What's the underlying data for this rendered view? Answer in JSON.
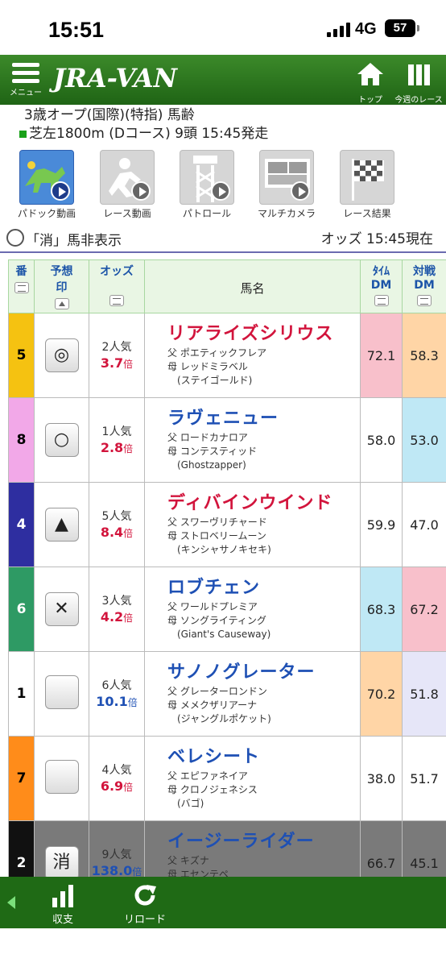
{
  "status": {
    "time": "15:51",
    "network": "4G",
    "battery": "57"
  },
  "header": {
    "menu_label": "メニュー",
    "logo": "JRA-VAN",
    "top_label": "トップ",
    "week_label": "今週のレース"
  },
  "race": {
    "line1": "3歳オープ(国際)(特指) 馬齢",
    "line2": "芝左1800m (Dコース) 9頭 15:45発走"
  },
  "media": [
    {
      "label": "パドック動画",
      "icon": "paddock-icon",
      "active": true
    },
    {
      "label": "レース動画",
      "icon": "jockey-icon",
      "active": false
    },
    {
      "label": "パトロール",
      "icon": "tower-icon",
      "active": false
    },
    {
      "label": "マルチカメラ",
      "icon": "multicam-icon",
      "active": false
    },
    {
      "label": "レース結果",
      "icon": "checkered-flag-icon",
      "active": false
    }
  ],
  "options": {
    "hide_label": "「消」馬非表示",
    "odds_time": "オッズ 15:45現在"
  },
  "table": {
    "headers": {
      "gate": "番",
      "mark_1": "予想",
      "mark_2": "印",
      "odds": "オッズ",
      "name": "馬名",
      "time_dm_1": "ﾀｲﾑ",
      "time_dm_2": "DM",
      "battle_dm_1": "対戦",
      "battle_dm_2": "DM"
    },
    "rows": [
      {
        "gate": "5",
        "gate_color": "#f5c211",
        "gate_text": "#000000",
        "mark": "◎",
        "pop": "2人気",
        "odds": "3.7",
        "odds_unit": "倍",
        "odds_color": "#d2143c",
        "name": "リアライズシリウス",
        "name_color": "#d2143c",
        "sire": "父 ポエティックフレア",
        "dam": "母 レッドミラベル",
        "bms": "(ステイゴールド)",
        "time_dm": "72.1",
        "time_bg": "#f8c0cb",
        "battle_dm": "58.3",
        "battle_bg": "#ffd5a6"
      },
      {
        "gate": "8",
        "gate_color": "#f2a8e8",
        "gate_text": "#000000",
        "mark": "○",
        "pop": "1人気",
        "odds": "2.8",
        "odds_unit": "倍",
        "odds_color": "#d2143c",
        "name": "ラヴェニュー",
        "name_color": "#1e50b4",
        "sire": "父 ロードカナロア",
        "dam": "母 コンテスティッド",
        "bms": "(Ghostzapper)",
        "time_dm": "58.0",
        "time_bg": "#ffffff",
        "battle_dm": "53.0",
        "battle_bg": "#bfe8f5"
      },
      {
        "gate": "4",
        "gate_color": "#2e2ea0",
        "gate_text": "#ffffff",
        "mark": "▲",
        "pop": "5人気",
        "odds": "8.4",
        "odds_unit": "倍",
        "odds_color": "#d2143c",
        "name": "ディバインウインド",
        "name_color": "#d2143c",
        "sire": "父 スワーヴリチャード",
        "dam": "母 ストロベリームーン",
        "bms": "(キンシャサノキセキ)",
        "time_dm": "59.9",
        "time_bg": "#ffffff",
        "battle_dm": "47.0",
        "battle_bg": "#ffffff"
      },
      {
        "gate": "6",
        "gate_color": "#2e9a64",
        "gate_text": "#ffffff",
        "mark": "✕",
        "pop": "3人気",
        "odds": "4.2",
        "odds_unit": "倍",
        "odds_color": "#d2143c",
        "name": "ロブチェン",
        "name_color": "#1e50b4",
        "sire": "父 ワールドプレミア",
        "dam": "母 ソングライティング",
        "bms": "(Giant's Causeway)",
        "time_dm": "68.3",
        "time_bg": "#bfe8f5",
        "battle_dm": "67.2",
        "battle_bg": "#f8c0cb"
      },
      {
        "gate": "1",
        "gate_color": "#ffffff",
        "gate_text": "#000000",
        "mark": "",
        "pop": "6人気",
        "odds": "10.1",
        "odds_unit": "倍",
        "odds_color": "#1e50b4",
        "name": "サノノグレーター",
        "name_color": "#1e50b4",
        "sire": "父 グレーターロンドン",
        "dam": "母 メメクザリアーナ",
        "bms": "(ジャングルポケット)",
        "time_dm": "70.2",
        "time_bg": "#ffd5a6",
        "battle_dm": "51.8",
        "battle_bg": "#e6e6f8"
      },
      {
        "gate": "7",
        "gate_color": "#ff8c1a",
        "gate_text": "#000000",
        "mark": "",
        "pop": "4人気",
        "odds": "6.9",
        "odds_unit": "倍",
        "odds_color": "#d2143c",
        "name": "ベレシート",
        "name_color": "#1e50b4",
        "sire": "父 エピファネイア",
        "dam": "母 クロノジェネシス",
        "bms": "(バゴ)",
        "time_dm": "38.0",
        "time_bg": "#ffffff",
        "battle_dm": "51.7",
        "battle_bg": "#ffffff"
      },
      {
        "gate": "2",
        "gate_color": "#111111",
        "gate_text": "#ffffff",
        "mark": "消",
        "pop": "9人気",
        "odds": "138.0",
        "odds_unit": "倍",
        "odds_color": "#1e50b4",
        "name": "イージーライダー",
        "name_color": "#1e50b4",
        "sire": "父 キズナ",
        "dam": "母 エセンテペ",
        "bms": "",
        "time_dm": "66.7",
        "time_bg": "#7a7a7a",
        "battle_dm": "45.1",
        "battle_bg": "#7a7a7a",
        "scratched": true
      }
    ]
  },
  "bottom": {
    "balance_label": "収支",
    "reload_label": "リロード"
  }
}
